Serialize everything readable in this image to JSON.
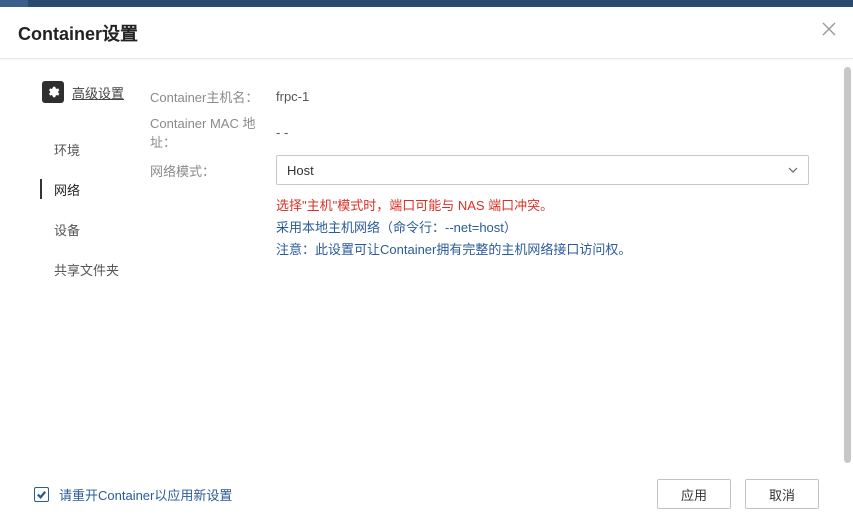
{
  "dialog": {
    "title": "Container设置",
    "advanced_label": "高级设置"
  },
  "nav": {
    "items": [
      {
        "label": "环境"
      },
      {
        "label": "网络"
      },
      {
        "label": "设备"
      },
      {
        "label": "共享文件夹"
      }
    ],
    "active_index": 1
  },
  "form": {
    "hostname_label": "Container主机名：",
    "hostname_value": "frpc-1",
    "mac_label": "Container MAC 地址：",
    "mac_value": "- -",
    "netmode_label": "网络模式：",
    "netmode_value": "Host"
  },
  "notes": {
    "warn": "选择\"主机\"模式时，端口可能与 NAS 端口冲突。",
    "line1": "采用本地主机网络（命令行：--net=host）",
    "line2": "注意：此设置可让Container拥有完整的主机网络接口访问权。"
  },
  "footer": {
    "restart_label": "请重开Container以应用新设置",
    "restart_checked": true,
    "apply": "应用",
    "cancel": "取消"
  }
}
